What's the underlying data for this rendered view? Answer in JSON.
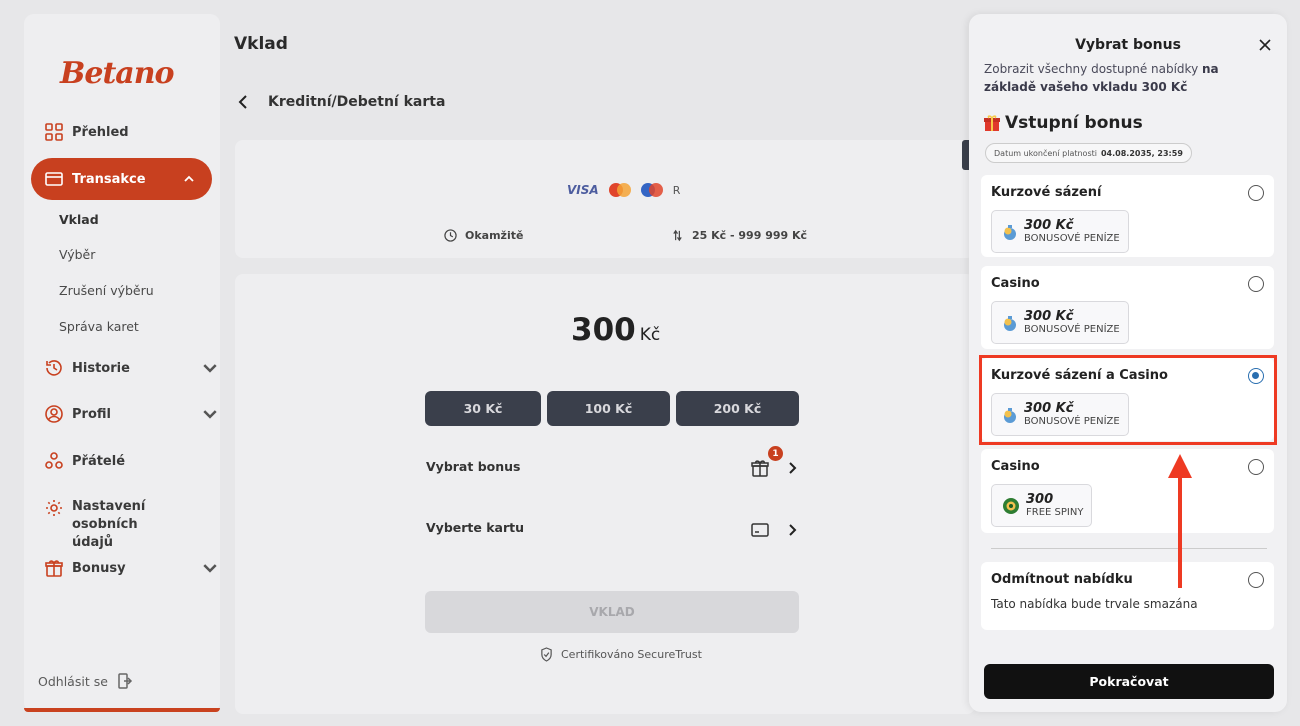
{
  "brand": {
    "logo_text": "Betano",
    "accent": "#c8401f"
  },
  "sidebar": {
    "items": [
      {
        "label": "Přehled",
        "icon": "grid-icon"
      },
      {
        "label": "Transakce",
        "icon": "card-icon",
        "active": true
      },
      {
        "label": "Historie",
        "icon": "history-icon"
      },
      {
        "label": "Profil",
        "icon": "user-icon"
      },
      {
        "label": "Přátelé",
        "icon": "friends-icon"
      },
      {
        "label": "Nastavení osobních údajů",
        "icon": "gear-icon"
      },
      {
        "label": "Bonusy",
        "icon": "gift-icon"
      }
    ],
    "sub_items": [
      "Vklad",
      "Výběr",
      "Zrušení výběru",
      "Správa karet"
    ],
    "logout": "Odhlásit se"
  },
  "main": {
    "page_title": "Vklad",
    "method_title": "Kreditní/Debetní karta",
    "payment_logos": {
      "visa": "VISA",
      "extra": "R"
    },
    "speed": "Okamžitě",
    "limits": "25 Kč - 999 999 Kč",
    "amount_value": "300",
    "amount_currency": "Kč",
    "presets": [
      "30 Kč",
      "100 Kč",
      "200 Kč"
    ],
    "bonus_row": "Vybrat bonus",
    "bonus_badge": "1",
    "card_row": "Vyberte kartu",
    "deposit_button": "VKLAD",
    "secure_text": "Certifikováno SecureTrust"
  },
  "modal": {
    "title": "Vybrat bonus",
    "desc_plain": "Zobrazit všechny dostupné nabídky ",
    "desc_bold": "na základě vašeho vkladu 300 Kč",
    "section_title": "Vstupní bonus",
    "expiry_label": "Datum ukončení platnosti",
    "expiry_value": "04.08.2035, 23:59",
    "options": [
      {
        "title": "Kurzové sázení",
        "main": "300 Kč",
        "sub": "BONUSOVÉ PENÍZE",
        "selected": false
      },
      {
        "title": "Casino",
        "main": "300 Kč",
        "sub": "BONUSOVÉ PENÍZE",
        "selected": false
      },
      {
        "title": "Kurzové sázení a Casino",
        "main": "300 Kč",
        "sub": "BONUSOVÉ PENÍZE",
        "selected": true
      },
      {
        "title": "Casino",
        "main": "300",
        "sub": "FREE SPINY",
        "selected": false
      }
    ],
    "decline_title": "Odmítnout nabídku",
    "decline_desc": "Tato nabídka bude trvale smazána",
    "continue_button": "Pokračovat",
    "highlight_color": "#ee3a23"
  }
}
